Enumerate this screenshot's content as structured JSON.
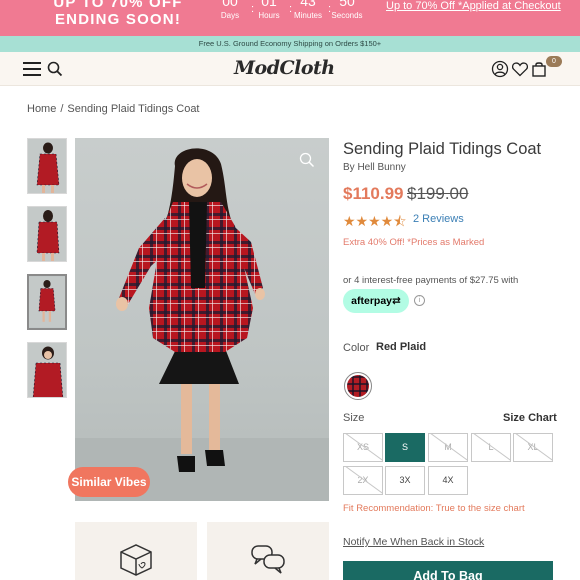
{
  "promo": {
    "headline": "UP TO 70% OFF ENDING SOON!",
    "countdown": [
      {
        "value": "00",
        "label": "Days"
      },
      {
        "value": "01",
        "label": "Hours"
      },
      {
        "value": "43",
        "label": "Minutes"
      },
      {
        "value": "50",
        "label": "Seconds"
      }
    ],
    "link": "Up to 70% Off *Applied at Checkout"
  },
  "shipping_banner": "Free U.S. Ground Economy Shipping on Orders $150+",
  "header": {
    "logo": "ModCloth",
    "cart_count": "0",
    "icons": [
      "menu-icon",
      "search-icon",
      "account-icon",
      "heart-icon",
      "bag-icon"
    ]
  },
  "breadcrumb": {
    "home": "Home",
    "separator": "/",
    "current": "Sending Plaid Tidings Coat"
  },
  "gallery": {
    "similar_button": "Similar Vibes"
  },
  "product": {
    "title": "Sending Plaid Tidings Coat",
    "brand": "By Hell Bunny",
    "sale_price": "$110.99",
    "original_price": "$199.00",
    "rating": 4.5,
    "stars_glyph": "★★★★⯪",
    "reviews": "2 Reviews",
    "promo_note": "Extra 40% Off! *Prices as Marked",
    "installments": "or 4 interest-free payments of $27.75 with",
    "afterpay": "afterpay⇄",
    "info_glyph": "i",
    "color_label": "Color",
    "color_value": "Red Plaid",
    "size_label": "Size",
    "size_chart": "Size Chart",
    "sizes": [
      {
        "label": "XS",
        "state": "unavailable"
      },
      {
        "label": "S",
        "state": "selected"
      },
      {
        "label": "M",
        "state": "unavailable"
      },
      {
        "label": "L",
        "state": "unavailable"
      },
      {
        "label": "XL",
        "state": "unavailable"
      },
      {
        "label": "2X",
        "state": "unavailable"
      },
      {
        "label": "3X",
        "state": "available"
      },
      {
        "label": "4X",
        "state": "available"
      }
    ],
    "fit_recommendation": "Fit Recommendation: True to the size chart",
    "notify": "Notify Me When Back in Stock",
    "add_to_bag": "Add To Bag"
  },
  "colors": {
    "promo_bg": "#f07a92",
    "shipping_bg": "#a7e0d4",
    "accent_teal": "#1a6a63",
    "sale_price": "#e37a5c",
    "star": "#e08a3c",
    "similar_button": "#f0765f",
    "afterpay_bg": "#b2fce4"
  }
}
